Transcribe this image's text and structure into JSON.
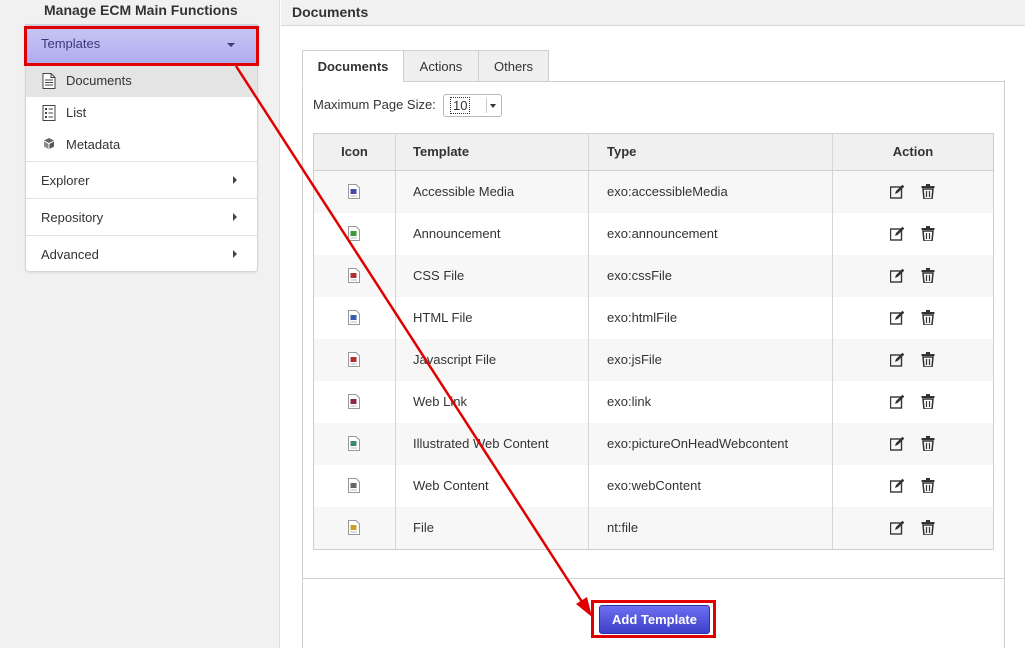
{
  "sidebar": {
    "title": "Manage ECM Main Functions",
    "templates_label": "Templates",
    "sub_items": {
      "documents": "Documents",
      "list": "List",
      "metadata": "Metadata"
    },
    "explorer_label": "Explorer",
    "repository_label": "Repository",
    "advanced_label": "Advanced"
  },
  "main": {
    "header_title": "Documents",
    "tabs": {
      "documents": "Documents",
      "actions": "Actions",
      "others": "Others"
    },
    "page_size_label": "Maximum Page Size:",
    "page_size_value": "10",
    "table": {
      "headers": {
        "icon": "Icon",
        "template": "Template",
        "type": "Type",
        "action": "Action"
      },
      "rows": [
        {
          "template": "Accessible Media",
          "type": "exo:accessibleMedia",
          "icon_color": "#4a4aa8"
        },
        {
          "template": "Announcement",
          "type": "exo:announcement",
          "icon_color": "#3a9a3a"
        },
        {
          "template": "CSS File",
          "type": "exo:cssFile",
          "icon_color": "#b03030"
        },
        {
          "template": "HTML File",
          "type": "exo:htmlFile",
          "icon_color": "#3a5ab0"
        },
        {
          "template": "Javascript File",
          "type": "exo:jsFile",
          "icon_color": "#b03030"
        },
        {
          "template": "Web Link",
          "type": "exo:link",
          "icon_color": "#8a2a4a"
        },
        {
          "template": "Illustrated Web Content",
          "type": "exo:pictureOnHeadWebcontent",
          "icon_color": "#3a8a6a"
        },
        {
          "template": "Web Content",
          "type": "exo:webContent",
          "icon_color": "#666666"
        },
        {
          "template": "File",
          "type": "nt:file",
          "icon_color": "#c9a030"
        }
      ]
    },
    "add_button_label": "Add Template"
  },
  "colors": {
    "selected_menu": "#aeaaf0",
    "primary_button": "#4a4ddb",
    "annotation": "#e00000"
  }
}
